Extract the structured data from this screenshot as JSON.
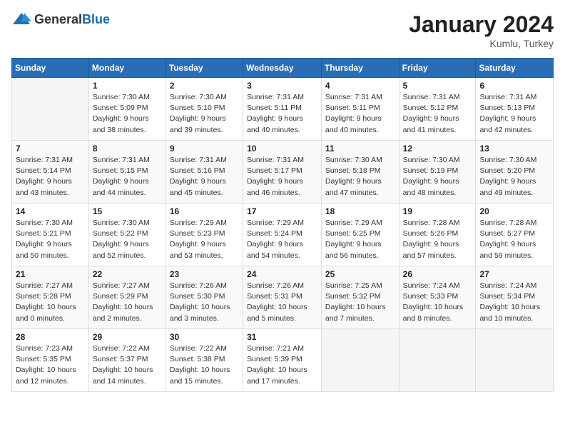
{
  "header": {
    "logo_general": "General",
    "logo_blue": "Blue",
    "title": "January 2024",
    "location": "Kumlu, Turkey"
  },
  "weekdays": [
    "Sunday",
    "Monday",
    "Tuesday",
    "Wednesday",
    "Thursday",
    "Friday",
    "Saturday"
  ],
  "weeks": [
    [
      {
        "day": "",
        "detail": ""
      },
      {
        "day": "1",
        "detail": "Sunrise: 7:30 AM\nSunset: 5:09 PM\nDaylight: 9 hours\nand 38 minutes."
      },
      {
        "day": "2",
        "detail": "Sunrise: 7:30 AM\nSunset: 5:10 PM\nDaylight: 9 hours\nand 39 minutes."
      },
      {
        "day": "3",
        "detail": "Sunrise: 7:31 AM\nSunset: 5:11 PM\nDaylight: 9 hours\nand 40 minutes."
      },
      {
        "day": "4",
        "detail": "Sunrise: 7:31 AM\nSunset: 5:11 PM\nDaylight: 9 hours\nand 40 minutes."
      },
      {
        "day": "5",
        "detail": "Sunrise: 7:31 AM\nSunset: 5:12 PM\nDaylight: 9 hours\nand 41 minutes."
      },
      {
        "day": "6",
        "detail": "Sunrise: 7:31 AM\nSunset: 5:13 PM\nDaylight: 9 hours\nand 42 minutes."
      }
    ],
    [
      {
        "day": "7",
        "detail": "Sunrise: 7:31 AM\nSunset: 5:14 PM\nDaylight: 9 hours\nand 43 minutes."
      },
      {
        "day": "8",
        "detail": "Sunrise: 7:31 AM\nSunset: 5:15 PM\nDaylight: 9 hours\nand 44 minutes."
      },
      {
        "day": "9",
        "detail": "Sunrise: 7:31 AM\nSunset: 5:16 PM\nDaylight: 9 hours\nand 45 minutes."
      },
      {
        "day": "10",
        "detail": "Sunrise: 7:31 AM\nSunset: 5:17 PM\nDaylight: 9 hours\nand 46 minutes."
      },
      {
        "day": "11",
        "detail": "Sunrise: 7:30 AM\nSunset: 5:18 PM\nDaylight: 9 hours\nand 47 minutes."
      },
      {
        "day": "12",
        "detail": "Sunrise: 7:30 AM\nSunset: 5:19 PM\nDaylight: 9 hours\nand 48 minutes."
      },
      {
        "day": "13",
        "detail": "Sunrise: 7:30 AM\nSunset: 5:20 PM\nDaylight: 9 hours\nand 49 minutes."
      }
    ],
    [
      {
        "day": "14",
        "detail": "Sunrise: 7:30 AM\nSunset: 5:21 PM\nDaylight: 9 hours\nand 50 minutes."
      },
      {
        "day": "15",
        "detail": "Sunrise: 7:30 AM\nSunset: 5:22 PM\nDaylight: 9 hours\nand 52 minutes."
      },
      {
        "day": "16",
        "detail": "Sunrise: 7:29 AM\nSunset: 5:23 PM\nDaylight: 9 hours\nand 53 minutes."
      },
      {
        "day": "17",
        "detail": "Sunrise: 7:29 AM\nSunset: 5:24 PM\nDaylight: 9 hours\nand 54 minutes."
      },
      {
        "day": "18",
        "detail": "Sunrise: 7:29 AM\nSunset: 5:25 PM\nDaylight: 9 hours\nand 56 minutes."
      },
      {
        "day": "19",
        "detail": "Sunrise: 7:28 AM\nSunset: 5:26 PM\nDaylight: 9 hours\nand 57 minutes."
      },
      {
        "day": "20",
        "detail": "Sunrise: 7:28 AM\nSunset: 5:27 PM\nDaylight: 9 hours\nand 59 minutes."
      }
    ],
    [
      {
        "day": "21",
        "detail": "Sunrise: 7:27 AM\nSunset: 5:28 PM\nDaylight: 10 hours\nand 0 minutes."
      },
      {
        "day": "22",
        "detail": "Sunrise: 7:27 AM\nSunset: 5:29 PM\nDaylight: 10 hours\nand 2 minutes."
      },
      {
        "day": "23",
        "detail": "Sunrise: 7:26 AM\nSunset: 5:30 PM\nDaylight: 10 hours\nand 3 minutes."
      },
      {
        "day": "24",
        "detail": "Sunrise: 7:26 AM\nSunset: 5:31 PM\nDaylight: 10 hours\nand 5 minutes."
      },
      {
        "day": "25",
        "detail": "Sunrise: 7:25 AM\nSunset: 5:32 PM\nDaylight: 10 hours\nand 7 minutes."
      },
      {
        "day": "26",
        "detail": "Sunrise: 7:24 AM\nSunset: 5:33 PM\nDaylight: 10 hours\nand 8 minutes."
      },
      {
        "day": "27",
        "detail": "Sunrise: 7:24 AM\nSunset: 5:34 PM\nDaylight: 10 hours\nand 10 minutes."
      }
    ],
    [
      {
        "day": "28",
        "detail": "Sunrise: 7:23 AM\nSunset: 5:35 PM\nDaylight: 10 hours\nand 12 minutes."
      },
      {
        "day": "29",
        "detail": "Sunrise: 7:22 AM\nSunset: 5:37 PM\nDaylight: 10 hours\nand 14 minutes."
      },
      {
        "day": "30",
        "detail": "Sunrise: 7:22 AM\nSunset: 5:38 PM\nDaylight: 10 hours\nand 15 minutes."
      },
      {
        "day": "31",
        "detail": "Sunrise: 7:21 AM\nSunset: 5:39 PM\nDaylight: 10 hours\nand 17 minutes."
      },
      {
        "day": "",
        "detail": ""
      },
      {
        "day": "",
        "detail": ""
      },
      {
        "day": "",
        "detail": ""
      }
    ]
  ]
}
